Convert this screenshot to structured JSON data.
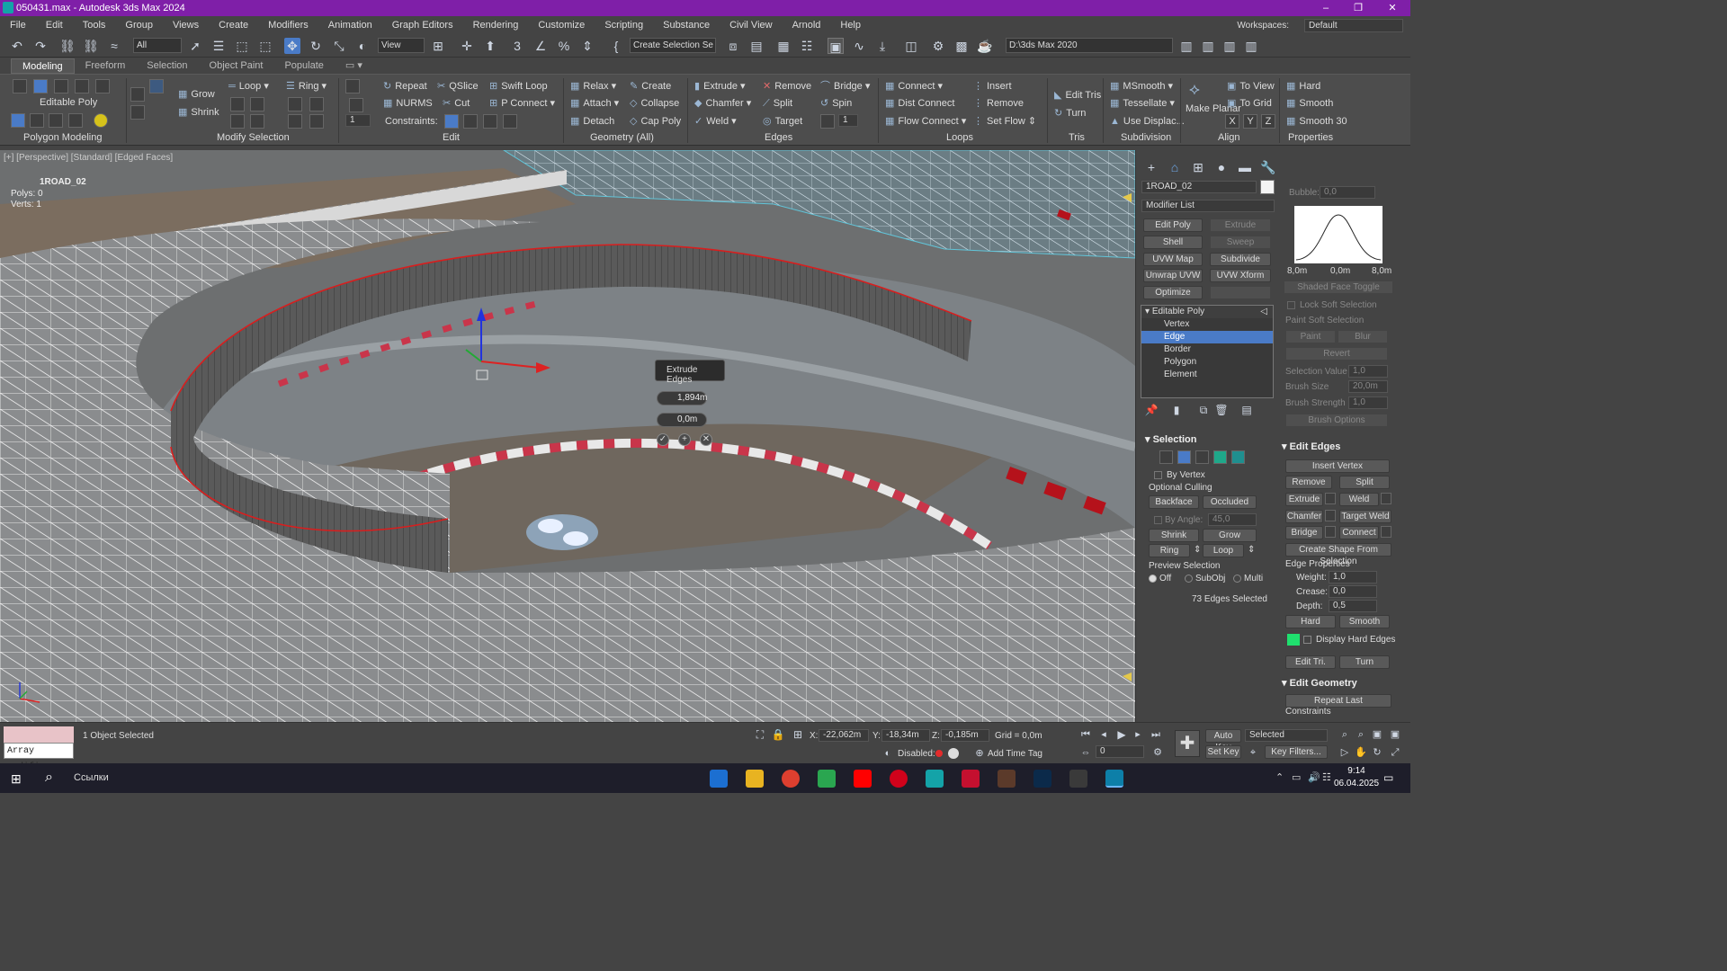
{
  "window": {
    "title": "050431.max - Autodesk 3ds Max 2024",
    "min": "–",
    "max": "❐",
    "close": "✕"
  },
  "menu": [
    "File",
    "Edit",
    "Tools",
    "Group",
    "Views",
    "Create",
    "Modifiers",
    "Animation",
    "Graph Editors",
    "Rendering",
    "Customize",
    "Scripting",
    "Substance",
    "Civil View",
    "Arnold",
    "Help"
  ],
  "workspaces": {
    "label": "Workspaces:",
    "value": "Default"
  },
  "toolbar": {
    "filter": "All",
    "refcoord": "View",
    "named_sel": "Create Selection Se",
    "project_path": "D:\\3ds Max 2020"
  },
  "ribbon_tabs": [
    "Modeling",
    "Freeform",
    "Selection",
    "Object Paint",
    "Populate"
  ],
  "ribbon": {
    "polygon_modeling": {
      "title": "Polygon Modeling",
      "editable": "Editable Poly"
    },
    "modify_selection": {
      "title": "Modify Selection",
      "grow": "Grow",
      "shrink": "Shrink",
      "loop": "Loop",
      "ring": "Ring"
    },
    "edit": {
      "title": "Edit",
      "repeat": "Repeat",
      "qslice": "QSlice",
      "swift_loop": "Swift Loop",
      "nurms": "NURMS",
      "cut": "Cut",
      "p_connect": "P Connect",
      "constraints": "Constraints:"
    },
    "geometry": {
      "title": "Geometry (All)",
      "relax": "Relax",
      "create": "Create",
      "attach": "Attach",
      "collapse": "Collapse",
      "detach": "Detach",
      "cap_poly": "Cap Poly"
    },
    "edges": {
      "title": "Edges",
      "extrude": "Extrude",
      "remove": "Remove",
      "bridge": "Bridge",
      "chamfer": "Chamfer",
      "split": "Split",
      "spin": "Spin",
      "weld": "Weld",
      "target": "Target"
    },
    "loops": {
      "title": "Loops",
      "connect": "Connect",
      "insert": "Insert",
      "dist_connect": "Dist Connect",
      "remove": "Remove",
      "flow_connect": "Flow Connect",
      "set_flow": "Set Flow"
    },
    "tris": {
      "title": "Tris",
      "edit_tris": "Edit Tris",
      "turn": "Turn"
    },
    "subdivision": {
      "title": "Subdivision",
      "msmooth": "MSmooth",
      "tessellate": "Tessellate",
      "use_displac": "Use Displac..."
    },
    "align": {
      "title": "Align",
      "make_planar": "Make Planar",
      "to_view": "To View",
      "to_grid": "To Grid",
      "x": "X",
      "y": "Y",
      "z": "Z"
    },
    "properties": {
      "title": "Properties",
      "hard": "Hard",
      "smooth": "Smooth",
      "smooth30": "Smooth 30"
    }
  },
  "viewport": {
    "label": "[+] [Perspective] [Standard] [Edged Faces]",
    "object": "1ROAD_02",
    "polys": "Polys: 0",
    "verts": "Verts: 1"
  },
  "caddy": {
    "title": "Extrude Edges",
    "height": "1,894m",
    "width": "0,0m"
  },
  "command_panel": {
    "object_name": "1ROAD_02",
    "modifier_list": "Modifier List",
    "modbuttons": [
      "Edit Poly",
      "Extrude",
      "Shell",
      "Sweep",
      "UVW Map",
      "Subdivide",
      "Unwrap UVW",
      "UVW Xform",
      "Optimize"
    ],
    "stack": {
      "root": "Editable Poly",
      "items": [
        "Vertex",
        "Edge",
        "Border",
        "Polygon",
        "Element"
      ],
      "active": "Edge"
    },
    "selection": {
      "title": "Selection",
      "by_vertex": "By Vertex",
      "optional_culling": "Optional Culling",
      "backface": "Backface",
      "occluded": "Occluded",
      "by_angle": "By Angle:",
      "angle": "45,0",
      "shrink": "Shrink",
      "grow": "Grow",
      "ring": "Ring",
      "loop": "Loop",
      "preview": "Preview Selection",
      "off": "Off",
      "subobj": "SubObj",
      "multi": "Multi",
      "count": "73 Edges Selected"
    },
    "soft": {
      "bubble_label": "Bubble:",
      "bubble": "0,0",
      "curve_left": "8,0m",
      "curve_mid": "0,0m",
      "curve_right": "8,0m",
      "shaded_toggle": "Shaded Face Toggle",
      "lock": "Lock Soft Selection",
      "paint_soft": "Paint Soft Selection",
      "paint": "Paint",
      "blur": "Blur",
      "revert": "Revert",
      "sel_value_label": "Selection Value",
      "sel_value": "1,0",
      "brush_size_label": "Brush Size",
      "brush_size": "20,0m",
      "brush_strength_label": "Brush Strength",
      "brush_strength": "1,0",
      "brush_options": "Brush Options"
    },
    "edit_edges": {
      "title": "Edit Edges",
      "insert_vertex": "Insert Vertex",
      "remove": "Remove",
      "split": "Split",
      "extrude": "Extrude",
      "weld": "Weld",
      "chamfer": "Chamfer",
      "target_weld": "Target Weld",
      "bridge": "Bridge",
      "connect": "Connect",
      "create_shape": "Create Shape From Selection",
      "edge_props": "Edge Properties",
      "weight_label": "Weight:",
      "weight": "1,0",
      "crease_label": "Crease:",
      "crease": "0,0",
      "depth_label": "Depth:",
      "depth": "0,5",
      "hard": "Hard",
      "smooth": "Smooth",
      "display_hard": "Display Hard Edges",
      "edit_tri": "Edit Tri.",
      "turn": "Turn"
    },
    "edit_geometry": {
      "title": "Edit Geometry",
      "repeat_last": "Repeat Last",
      "constraints": "Constraints"
    }
  },
  "status": {
    "script_listener": "Array modifi:",
    "selected": "1 Object Selected",
    "x_label": "X:",
    "x": "-22,062m",
    "y_label": "Y:",
    "y": "-18,34m",
    "z_label": "Z:",
    "z": "-0,185m",
    "grid": "Grid = 0,0m",
    "disabled": "Disabled:",
    "add_time_tag": "Add Time Tag",
    "auto_key": "Auto Key",
    "set_key": "Set Key",
    "selected_mode": "Selected",
    "key_filters": "Key Filters...",
    "frame": "0"
  },
  "taskbar": {
    "search": "Ссылки",
    "time": "9:14",
    "date": "06.04.2025"
  },
  "colors": {
    "title_bar": "#7f1fa8",
    "accent": "#4a7bc7",
    "edge_red": "#d81e1e"
  }
}
